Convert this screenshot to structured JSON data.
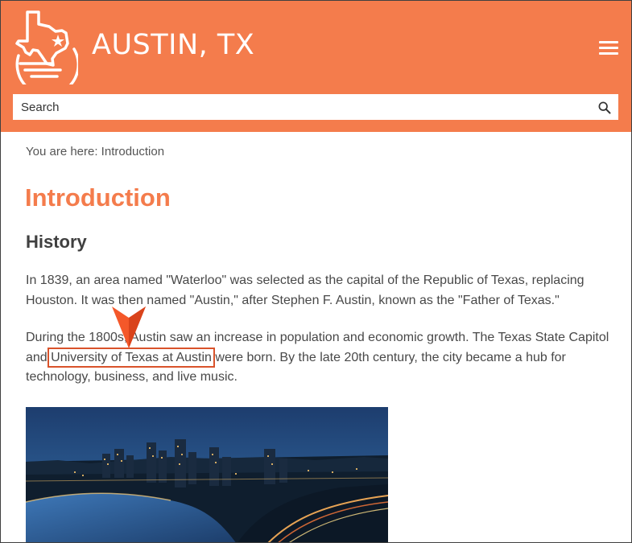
{
  "header": {
    "site_title": "AUSTIN, TX",
    "brand_color": "#f47c4c",
    "logo_icon": "texas-star-logo-icon",
    "menu_icon": "hamburger-menu-icon"
  },
  "search": {
    "placeholder": "Search",
    "icon": "search-icon"
  },
  "breadcrumb": "You are here: Introduction",
  "page": {
    "title": "Introduction",
    "section_title": "History",
    "para1": "In 1839, an area named \"Waterloo\" was selected as the capital of the Republic of Texas, replacing Houston. It was then named \"Austin,\" after Stephen F. Austin, known as the \"Father of Texas.\"",
    "para2_before": "During the 1800s, Austin saw an increase in population and economic growth. The Texas State Capitol and ",
    "para2_link": "University of Texas at Austin",
    "para2_after": " were born. By the late 20th century, the city became a hub for technology, business, and live music.",
    "image_icon": "austin-skyline-night-photo"
  },
  "annotation": {
    "highlight_color": "#d9532b",
    "pointer_icon": "pointer-arrow-icon"
  }
}
